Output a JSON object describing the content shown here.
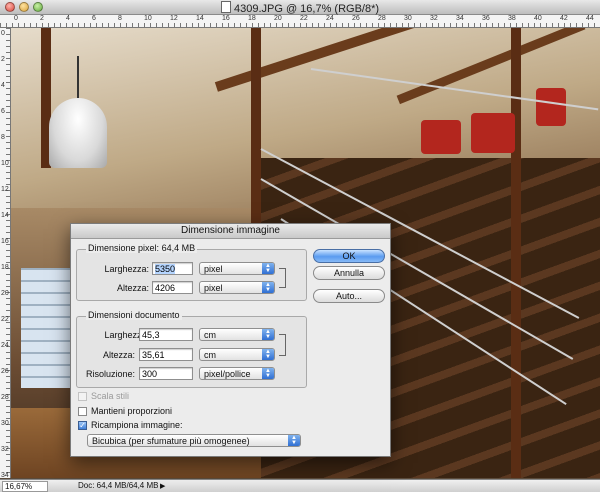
{
  "window": {
    "title": "4309.JPG @ 16,7% (RGB/8*)"
  },
  "rulers": {
    "h_labels": [
      "0",
      "2",
      "4",
      "6",
      "8",
      "10",
      "12",
      "14",
      "16",
      "18",
      "20",
      "22",
      "24",
      "26",
      "28",
      "30",
      "32",
      "34",
      "36",
      "38",
      "40",
      "42",
      "44"
    ],
    "v_labels": [
      "0",
      "2",
      "4",
      "6",
      "8",
      "10",
      "12",
      "14",
      "16",
      "18",
      "20",
      "22",
      "24",
      "26",
      "28",
      "30",
      "32",
      "34"
    ]
  },
  "statusbar": {
    "zoom": "16,67%",
    "doc_info": "Doc: 64,4 MB/64,4 MB",
    "arrow": "▶"
  },
  "dialog": {
    "title": "Dimensione immagine",
    "pixel_group": {
      "label": "Dimensione pixel:",
      "size": "64,4 MB",
      "width_label": "Larghezza:",
      "width_value": "5350",
      "width_unit": "pixel",
      "height_label": "Altezza:",
      "height_value": "4206",
      "height_unit": "pixel"
    },
    "document_group": {
      "label": "Dimensioni documento",
      "width_label": "Larghezza:",
      "width_value": "45,3",
      "width_unit": "cm",
      "height_label": "Altezza:",
      "height_value": "35,61",
      "height_unit": "cm",
      "resolution_label": "Risoluzione:",
      "resolution_value": "300",
      "resolution_unit": "pixel/pollice"
    },
    "options": {
      "scale_styles": "Scala stili",
      "constrain": "Mantieni proporzioni",
      "resample": "Ricampiona immagine:",
      "resample_method": "Bicubica (per sfumature più omogenee)"
    },
    "buttons": {
      "ok": "OK",
      "cancel": "Annulla",
      "auto": "Auto..."
    }
  },
  "colors": {
    "accent": "#5a9bf0",
    "selection": "#b5d5ff"
  }
}
